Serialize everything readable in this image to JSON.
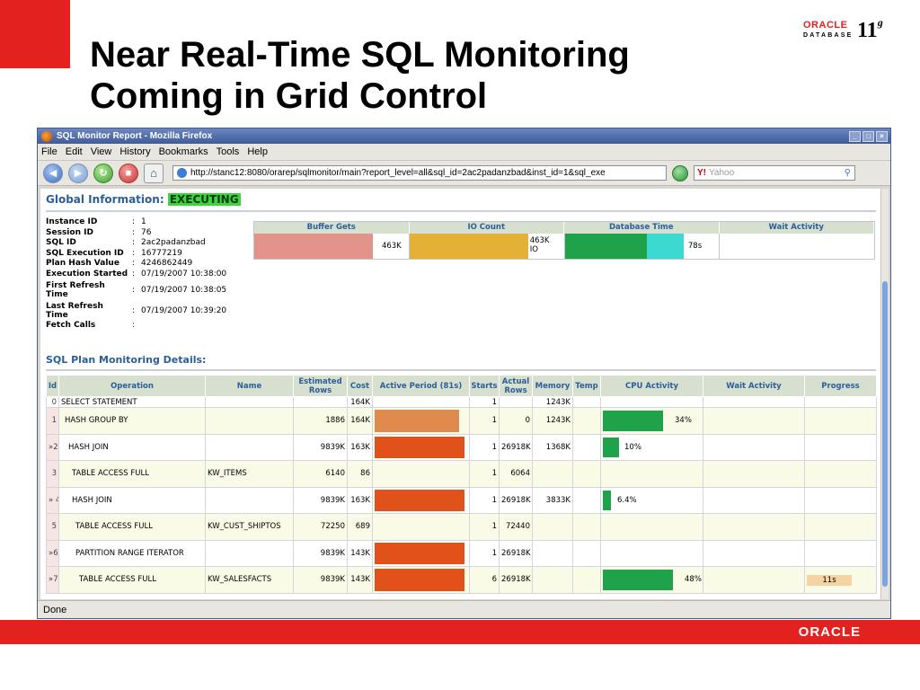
{
  "slide": {
    "title_line1": "Near Real-Time SQL Monitoring",
    "title_line2": "Coming in Grid Control",
    "logo_top": "ORACLE",
    "logo_db": "DATABASE",
    "logo_version": "11",
    "logo_version_sup": "g",
    "footer_logo": "ORACLE"
  },
  "browser": {
    "window_title": "SQL Monitor Report - Mozilla Firefox",
    "menu": [
      "File",
      "Edit",
      "View",
      "History",
      "Bookmarks",
      "Tools",
      "Help"
    ],
    "url": "http://stanc12:8080/orarep/sqlmonitor/main?report_level=all&sql_id=2ac2padanzbad&inst_id=1&sql_exe",
    "search_placeholder": "Yahoo",
    "status": "Done"
  },
  "global": {
    "title": "Global Information:",
    "status": "EXECUTING",
    "fields": [
      {
        "key": "Instance ID",
        "value": "1"
      },
      {
        "key": "Session ID",
        "value": "76"
      },
      {
        "key": "SQL ID",
        "value": "2ac2padanzbad"
      },
      {
        "key": "SQL Execution ID",
        "value": "16777219"
      },
      {
        "key": "Plan Hash Value",
        "value": "4246862449"
      },
      {
        "key": "Execution Started",
        "value": "07/19/2007 10:38:00"
      },
      {
        "key": "First Refresh Time",
        "value": "07/19/2007 10:38:05"
      },
      {
        "key": "Last Refresh Time",
        "value": "07/19/2007 10:39:20"
      },
      {
        "key": "Fetch Calls",
        "value": ""
      }
    ],
    "metrics": {
      "headers": [
        "Buffer Gets",
        "IO Count",
        "Database Time",
        "Wait Activity"
      ],
      "buffer_gets": "463K",
      "io_count": "463K",
      "io_unit": "IO",
      "database_time": "78s"
    }
  },
  "plan": {
    "title": "SQL Plan Monitoring Details:",
    "headers": [
      "Id",
      "Operation",
      "Name",
      "Estimated Rows",
      "Cost",
      "Active Period (81s)",
      "Starts",
      "Actual Rows",
      "Memory",
      "Temp",
      "CPU Activity",
      "Wait Activity",
      "Progress"
    ],
    "rows": [
      {
        "id": "0",
        "op": "SELECT STATEMENT",
        "name": "",
        "est": "",
        "cost": "164K",
        "starts": "1",
        "actual": "",
        "mem": "1243K",
        "cpu": "",
        "prog": ""
      },
      {
        "id": "1",
        "op": "HASH GROUP BY",
        "name": "",
        "est": "1886",
        "cost": "164K",
        "starts": "1",
        "actual": "0",
        "mem": "1243K",
        "cpu": "34%",
        "prog": ""
      },
      {
        "id": "2",
        "op": "HASH JOIN",
        "name": "",
        "est": "9839K",
        "cost": "163K",
        "starts": "1",
        "actual": "26918K",
        "mem": "1368K",
        "cpu": "10%",
        "prog": ""
      },
      {
        "id": "3",
        "op": "TABLE ACCESS FULL",
        "name": "KW_ITEMS",
        "est": "6140",
        "cost": "86",
        "starts": "1",
        "actual": "6064",
        "mem": "",
        "cpu": "",
        "prog": ""
      },
      {
        "id": "4",
        "op": "HASH JOIN",
        "name": "",
        "est": "9839K",
        "cost": "163K",
        "starts": "1",
        "actual": "26918K",
        "mem": "3833K",
        "cpu": "6.4%",
        "prog": ""
      },
      {
        "id": "5",
        "op": "TABLE ACCESS FULL",
        "name": "KW_CUST_SHIPTOS",
        "est": "72250",
        "cost": "689",
        "starts": "1",
        "actual": "72440",
        "mem": "",
        "cpu": "",
        "prog": ""
      },
      {
        "id": "6",
        "op": "PARTITION RANGE ITERATOR",
        "name": "",
        "est": "9839K",
        "cost": "143K",
        "starts": "1",
        "actual": "26918K",
        "mem": "",
        "cpu": "",
        "prog": ""
      },
      {
        "id": "7",
        "op": "TABLE ACCESS FULL",
        "name": "KW_SALESFACTS",
        "est": "9839K",
        "cost": "143K",
        "starts": "6",
        "actual": "26918K",
        "mem": "",
        "cpu": "48%",
        "prog": "11s"
      }
    ]
  },
  "colors": {
    "slide_red": "#e3211f",
    "cpu_green": "#1ea24a",
    "active_orange": "#e0521a"
  }
}
